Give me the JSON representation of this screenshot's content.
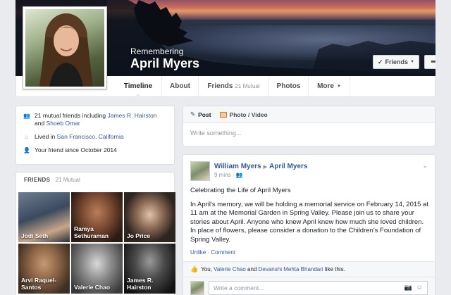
{
  "cover": {
    "remembering": "Remembering",
    "name": "April Myers",
    "friends_button": "Friends",
    "more_button": "•••"
  },
  "nav": {
    "tabs": [
      {
        "label": "Timeline",
        "extra": ""
      },
      {
        "label": "About",
        "extra": ""
      },
      {
        "label": "Friends",
        "extra": "21 Mutual"
      },
      {
        "label": "Photos",
        "extra": ""
      },
      {
        "label": "More",
        "extra": ""
      }
    ]
  },
  "intro": {
    "mutual_prefix": "21 mutual friends including ",
    "mutual_name1": "James R. Hairston",
    "mutual_and": " and ",
    "mutual_name2": "Shoeb Omar",
    "lived_prefix": "Lived in ",
    "lived_place": "San Francisco, California",
    "friend_since": "Your friend since October 2014"
  },
  "friends_card": {
    "title": "FRIENDS",
    "count": "· 21 Mutual",
    "friends": [
      {
        "name": "Jodi Seth"
      },
      {
        "name": "Ramya Sethuraman"
      },
      {
        "name": "Jo Price"
      },
      {
        "name": "Arvi Raquel-Santos"
      },
      {
        "name": "Valerie Chao"
      },
      {
        "name": "James R. Hairston"
      }
    ]
  },
  "composer": {
    "post_tab": "Post",
    "photo_tab": "Photo / Video",
    "placeholder": "Write something..."
  },
  "post": {
    "author": "William Myers",
    "target": "April Myers",
    "time": "9 mins",
    "title_line": "Celebrating the Life of April Myers",
    "body": "In April's memory, we will be holding a memorial service on February 14, 2015 at 11 am at the Memorial Garden in Spring Valley. Please join us to share your stories about April. Anyone who knew April knew how much she loved children. In place of flowers, please consider a donation to the Children's Foundation of Spring Valley.",
    "unlike": "Unlike",
    "comment": "Comment",
    "likes_prefix": "You, ",
    "likes_name1": "Valerie Chao",
    "likes_and": " and ",
    "likes_name2": "Devanshi Mehta Bhandari",
    "likes_suffix": " like this.",
    "comment_placeholder": "Write a comment..."
  }
}
